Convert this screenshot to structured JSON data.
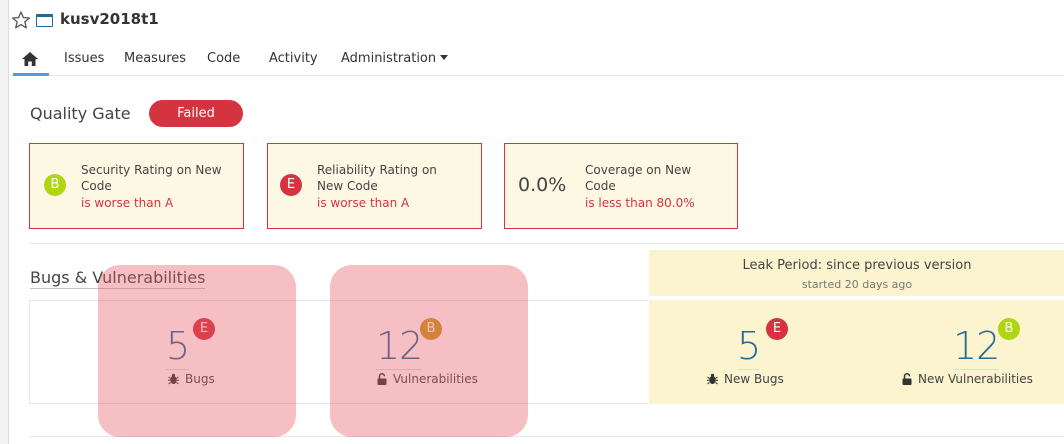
{
  "project": {
    "name": "kusv2018t1"
  },
  "nav": {
    "items": [
      "Issues",
      "Measures",
      "Code",
      "Activity",
      "Administration"
    ]
  },
  "quality_gate": {
    "title": "Quality Gate",
    "status": "Failed",
    "conditions": [
      {
        "rating": "B",
        "label_line1": "Security Rating on New",
        "label_line2": "Code",
        "error": "is worse than A"
      },
      {
        "rating": "E",
        "label_line1": "Reliability Rating on",
        "label_line2": "New Code",
        "error": "is worse than A"
      },
      {
        "value": "0.0%",
        "label_line1": "Coverage on New",
        "label_line2": "Code",
        "error": "is less than 80.0%"
      }
    ]
  },
  "bugs_vulns": {
    "title": "Bugs & Vulnerabilities",
    "overall": {
      "bugs": {
        "value": "5",
        "rating": "E",
        "label": "Bugs"
      },
      "vulnerabilities": {
        "value": "12",
        "rating": "B",
        "label": "Vulnerabilities"
      }
    },
    "leak": {
      "period": "Leak Period: since previous version",
      "started": "started 20 days ago",
      "new_bugs": {
        "value": "5",
        "rating": "E",
        "label": "New Bugs"
      },
      "new_vulnerabilities": {
        "value": "12",
        "rating": "B",
        "label": "New Vulnerabilities"
      }
    }
  },
  "colors": {
    "error_red": "#d4333f",
    "rating_b": "#b0d513",
    "rating_b_muted": "#c8a024",
    "leak_bg": "#fcf3cf",
    "highlight_overlay": "rgba(229,88,100,0.38)"
  },
  "icons": [
    "star-icon",
    "folder-icon",
    "home-icon",
    "bug-icon",
    "lock-icon",
    "caret-down-icon"
  ]
}
